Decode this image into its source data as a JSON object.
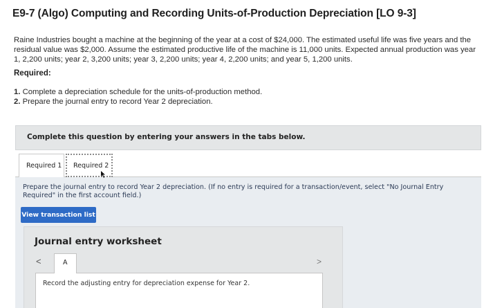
{
  "header": {
    "title": "E9-7 (Algo) Computing and Recording Units-of-Production Depreciation [LO 9-3]"
  },
  "problem": {
    "text": "Raine Industries bought a machine at the beginning of the year at a cost of $24,000. The estimated useful life was five years and the residual value was $2,000. Assume the estimated productive life of the machine is 11,000 units. Expected annual production was year 1, 2,200 units; year 2, 3,200 units; year 3, 2,200 units; year 4, 2,200 units; and year 5, 1,200 units."
  },
  "required": {
    "heading": "Required:",
    "items": [
      {
        "number": "1.",
        "text": "Complete a depreciation schedule for the units-of-production method."
      },
      {
        "number": "2.",
        "text": "Prepare the journal entry to record Year 2 depreciation."
      }
    ]
  },
  "instruction_bar": {
    "text": "Complete this question by entering your answers in the tabs below."
  },
  "tabs": [
    {
      "label": "Required 1",
      "active": false
    },
    {
      "label": "Required 2",
      "active": true
    }
  ],
  "tab_panel": {
    "prompt": "Prepare the journal entry to record Year 2 depreciation. (If no entry is required for a transaction/event, select \"No Journal Entry Required\" in the first account field.)",
    "view_button": "View transaction list"
  },
  "worksheet": {
    "title": "Journal entry worksheet",
    "prev_glyph": "<",
    "next_glyph": ">",
    "entry_tab": "A",
    "entry_description": "Record the adjusting entry for depreciation expense for Year 2."
  },
  "colors": {
    "button_blue": "#2e6bc6",
    "panel_bg": "#e9edf1",
    "bar_bg": "#e4e6e7",
    "prompt_text": "#2b3a55"
  }
}
